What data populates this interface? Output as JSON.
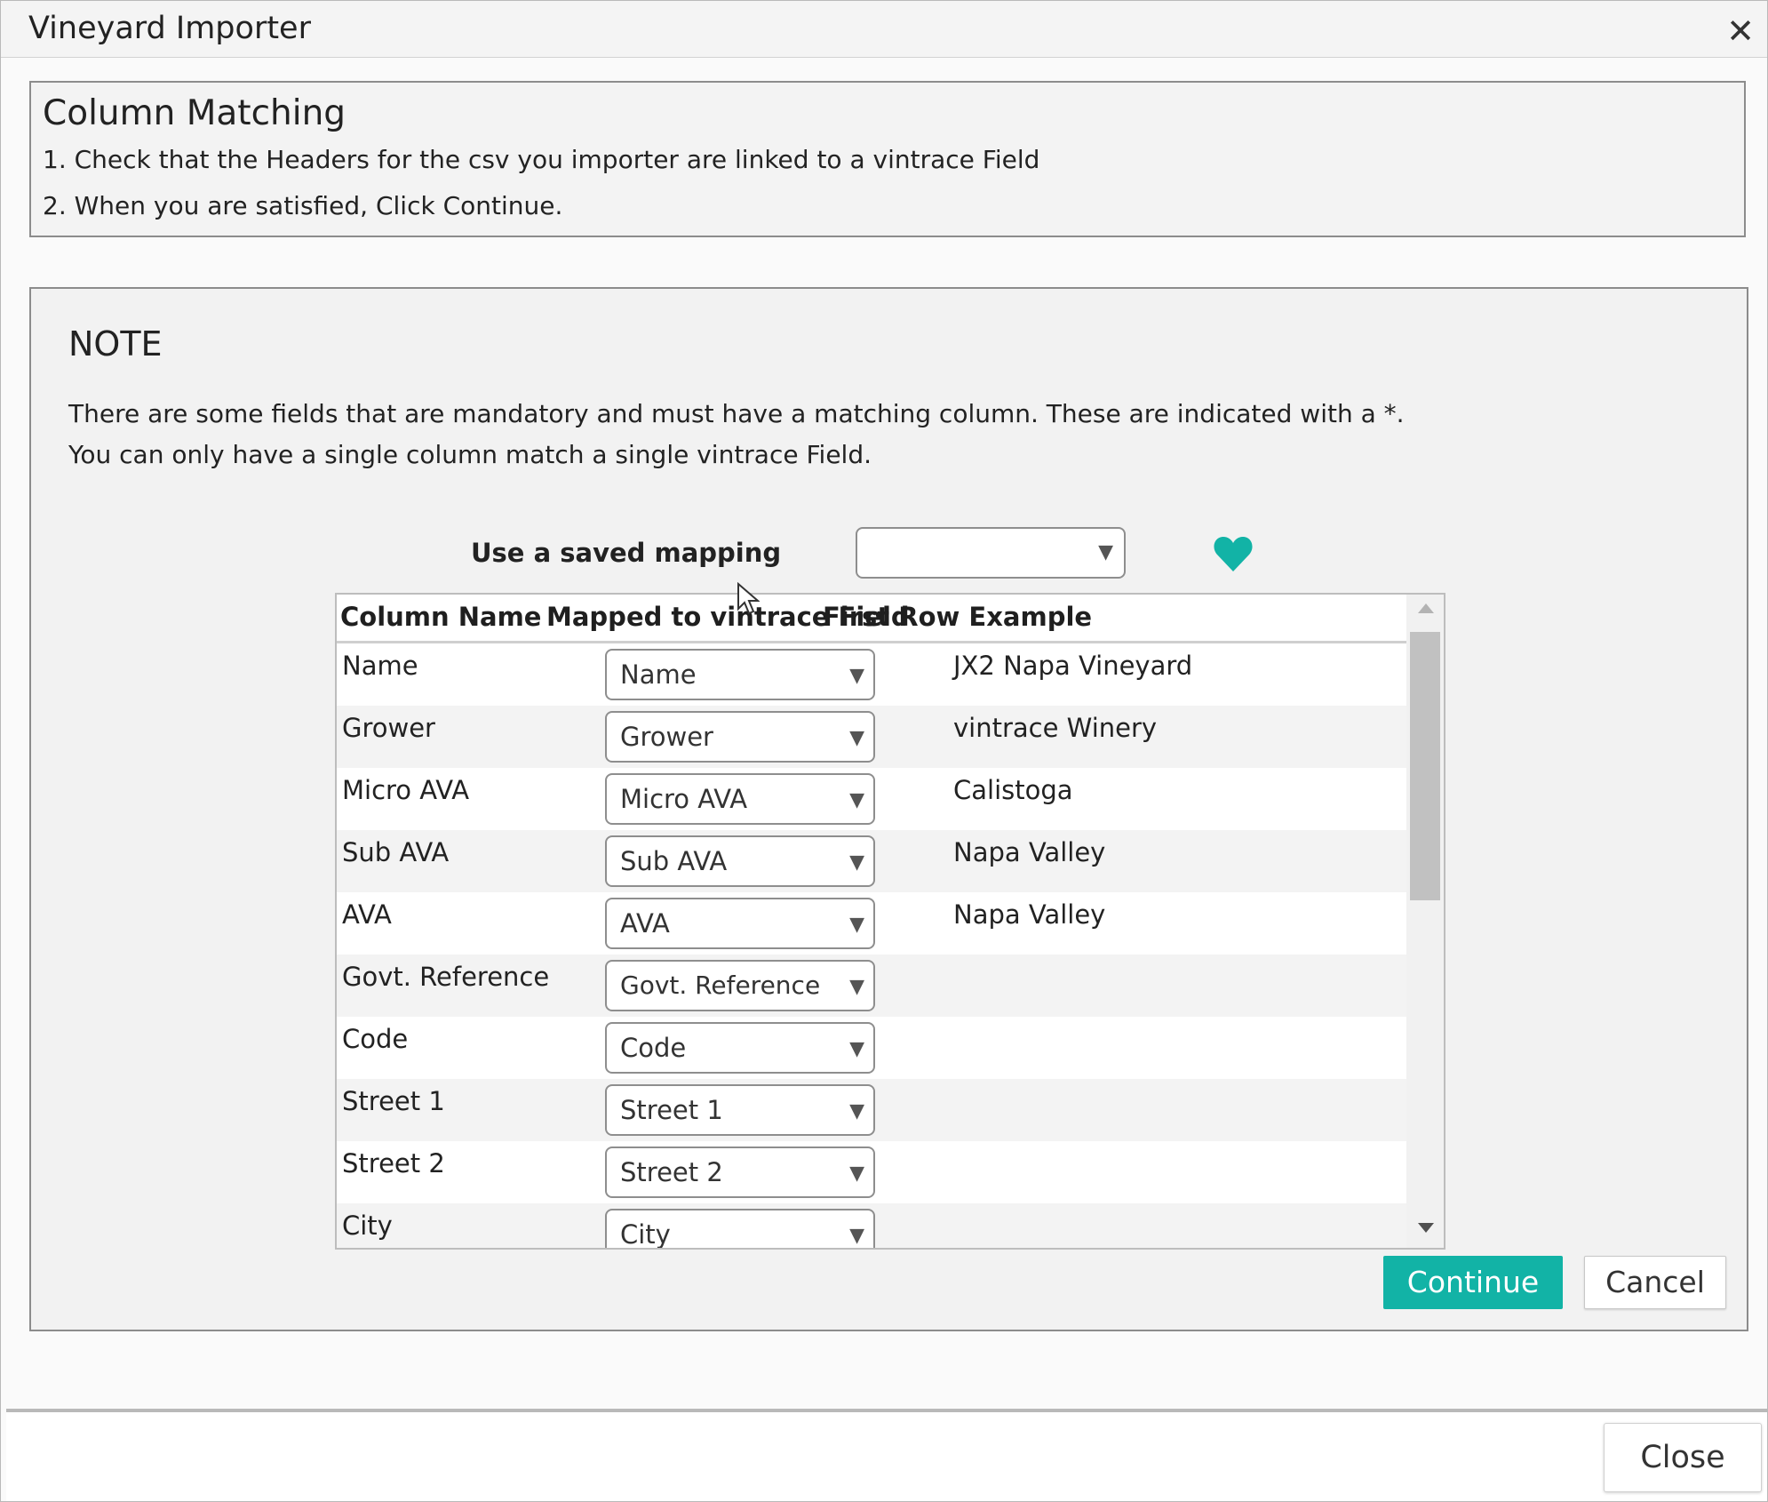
{
  "window": {
    "title": "Vineyard Importer"
  },
  "instructions": {
    "title": "Column Matching",
    "line1": "1. Check that the Headers for the csv you importer are linked to a vintrace Field",
    "line2": "2. When you are satisfied, Click Continue."
  },
  "note": {
    "title": "NOTE",
    "line1": "There are some fields that are mandatory and must have a matching column. These are indicated with a *.",
    "line2": "You can only have a single column match a single vintrace Field."
  },
  "saved_mapping": {
    "label": "Use a saved mapping",
    "value": ""
  },
  "table": {
    "headers": {
      "column_name": "Column Name",
      "mapped": "Mapped to vintrace Field",
      "example": "First Row Example"
    },
    "rows": [
      {
        "name": "Name",
        "mapped": "Name",
        "example": "JX2 Napa Vineyard"
      },
      {
        "name": "Grower",
        "mapped": "Grower",
        "example": "vintrace Winery"
      },
      {
        "name": "Micro AVA",
        "mapped": "Micro AVA",
        "example": "Calistoga"
      },
      {
        "name": "Sub AVA",
        "mapped": "Sub AVA",
        "example": "Napa Valley"
      },
      {
        "name": "AVA",
        "mapped": "AVA",
        "example": "Napa Valley"
      },
      {
        "name": "Govt. Reference",
        "mapped": "Govt. Reference",
        "example": ""
      },
      {
        "name": "Code",
        "mapped": "Code",
        "example": ""
      },
      {
        "name": "Street 1",
        "mapped": "Street 1",
        "example": ""
      },
      {
        "name": "Street 2",
        "mapped": "Street 2",
        "example": ""
      },
      {
        "name": "City",
        "mapped": "City",
        "example": ""
      }
    ]
  },
  "buttons": {
    "continue": "Continue",
    "cancel": "Cancel",
    "close": "Close",
    "close_x": "✕"
  },
  "colors": {
    "accent": "#12b3a6",
    "heart": "#12b3a6"
  },
  "icons": {
    "dropdown": "▼",
    "heart": "heart-icon"
  }
}
